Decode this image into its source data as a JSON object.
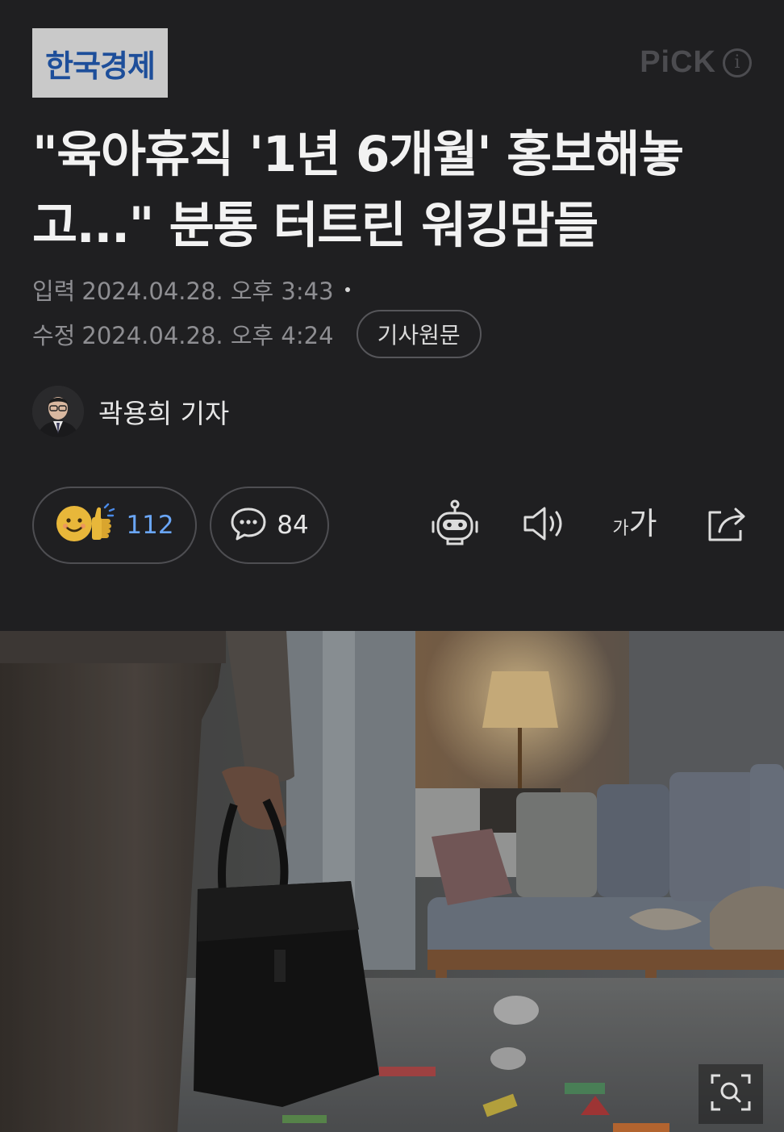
{
  "header": {
    "press_name": "한국경제",
    "pick_label": "PiCK",
    "pick_info_glyph": "i"
  },
  "article": {
    "headline": "\"육아휴직 '1년 6개월' 홍보해놓고...\" 분통 터트린 워킹맘들",
    "published_label": "입력",
    "published_value": "2024.04.28. 오후 3:43",
    "modified_label": "수정",
    "modified_value": "2024.04.28. 오후 4:24",
    "original_button": "기사원문",
    "reporter": "곽용희 기자"
  },
  "actions": {
    "reaction_count": "112",
    "comment_count": "84",
    "font_small": "가",
    "font_large": "가"
  },
  "colors": {
    "background": "#1f1f21",
    "press_logo_bg": "#c9c9c9",
    "press_logo_text": "#1d4e9a",
    "reaction_count": "#6aa6f7"
  },
  "icons": [
    "robot-summary-icon",
    "speaker-icon",
    "font-size-icon",
    "share-icon",
    "comment-bubble-icon",
    "reaction-emoji-icon",
    "zoom-icon"
  ]
}
